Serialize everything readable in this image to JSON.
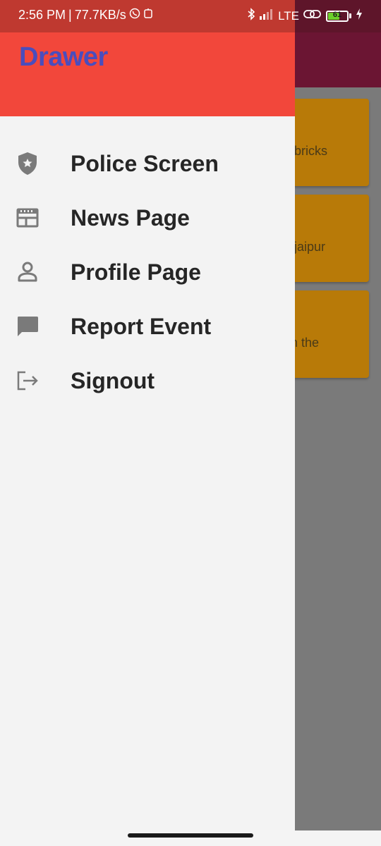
{
  "status_bar": {
    "time": "2:56 PM",
    "separator": "|",
    "network_speed": "77.7KB/s",
    "network_type": "LTE",
    "battery_level": "61",
    "battery_fraction": 0.61,
    "icons": [
      "whatsapp-icon",
      "notification-icon",
      "bluetooth-icon",
      "signal-icon",
      "link-icon",
      "battery-icon",
      "charging-icon"
    ]
  },
  "drawer": {
    "title": "Drawer",
    "header_color": "#f2473b",
    "title_color": "#4a4dbd",
    "items": [
      {
        "label": "Police Screen",
        "icon": "police-shield-icon"
      },
      {
        "label": "News Page",
        "icon": "news-icon"
      },
      {
        "label": "Profile Page",
        "icon": "person-icon"
      },
      {
        "label": "Report Event",
        "icon": "chat-bubble-icon"
      },
      {
        "label": "Signout",
        "icon": "logout-icon"
      }
    ]
  },
  "background": {
    "appbar_color": "#6b1533",
    "cards": [
      {
        "text": "g bricks"
      },
      {
        "text": "e jaipur"
      },
      {
        "text": "on the"
      }
    ]
  }
}
